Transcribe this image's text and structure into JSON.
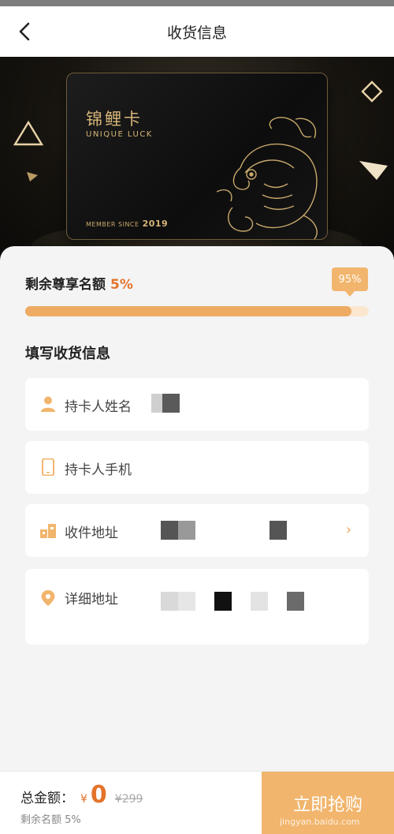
{
  "nav": {
    "title": "收货信息"
  },
  "card": {
    "name_cn": "锦鲤卡",
    "name_en": "UNIQUE LUCK",
    "member_since_label": "MEMBER SINCE",
    "member_since_year": "2019"
  },
  "quota": {
    "label": "剩余尊享名额",
    "percent_text": "5%",
    "progress_text": "95%",
    "progress_value": 0.95
  },
  "form": {
    "title": "填写收货信息",
    "fields": [
      {
        "label": "持卡人姓名",
        "icon": "user-icon"
      },
      {
        "label": "持卡人手机",
        "icon": "phone-icon"
      },
      {
        "label": "收件地址",
        "icon": "building-icon"
      },
      {
        "label": "详细地址",
        "icon": "location-pin-icon"
      }
    ]
  },
  "footer": {
    "total_label": "总金额：",
    "currency": "¥",
    "total_value": "0",
    "original_price": "¥299",
    "remaining_text": "剩余名额 5%",
    "submit_label": "立即抢购"
  },
  "watermark": "jingyan.baidu.com",
  "colors": {
    "accent": "#e3742b",
    "gold": "#f2b56d",
    "progress_fill": "#eeab64",
    "progress_track": "#fbe7d0"
  }
}
